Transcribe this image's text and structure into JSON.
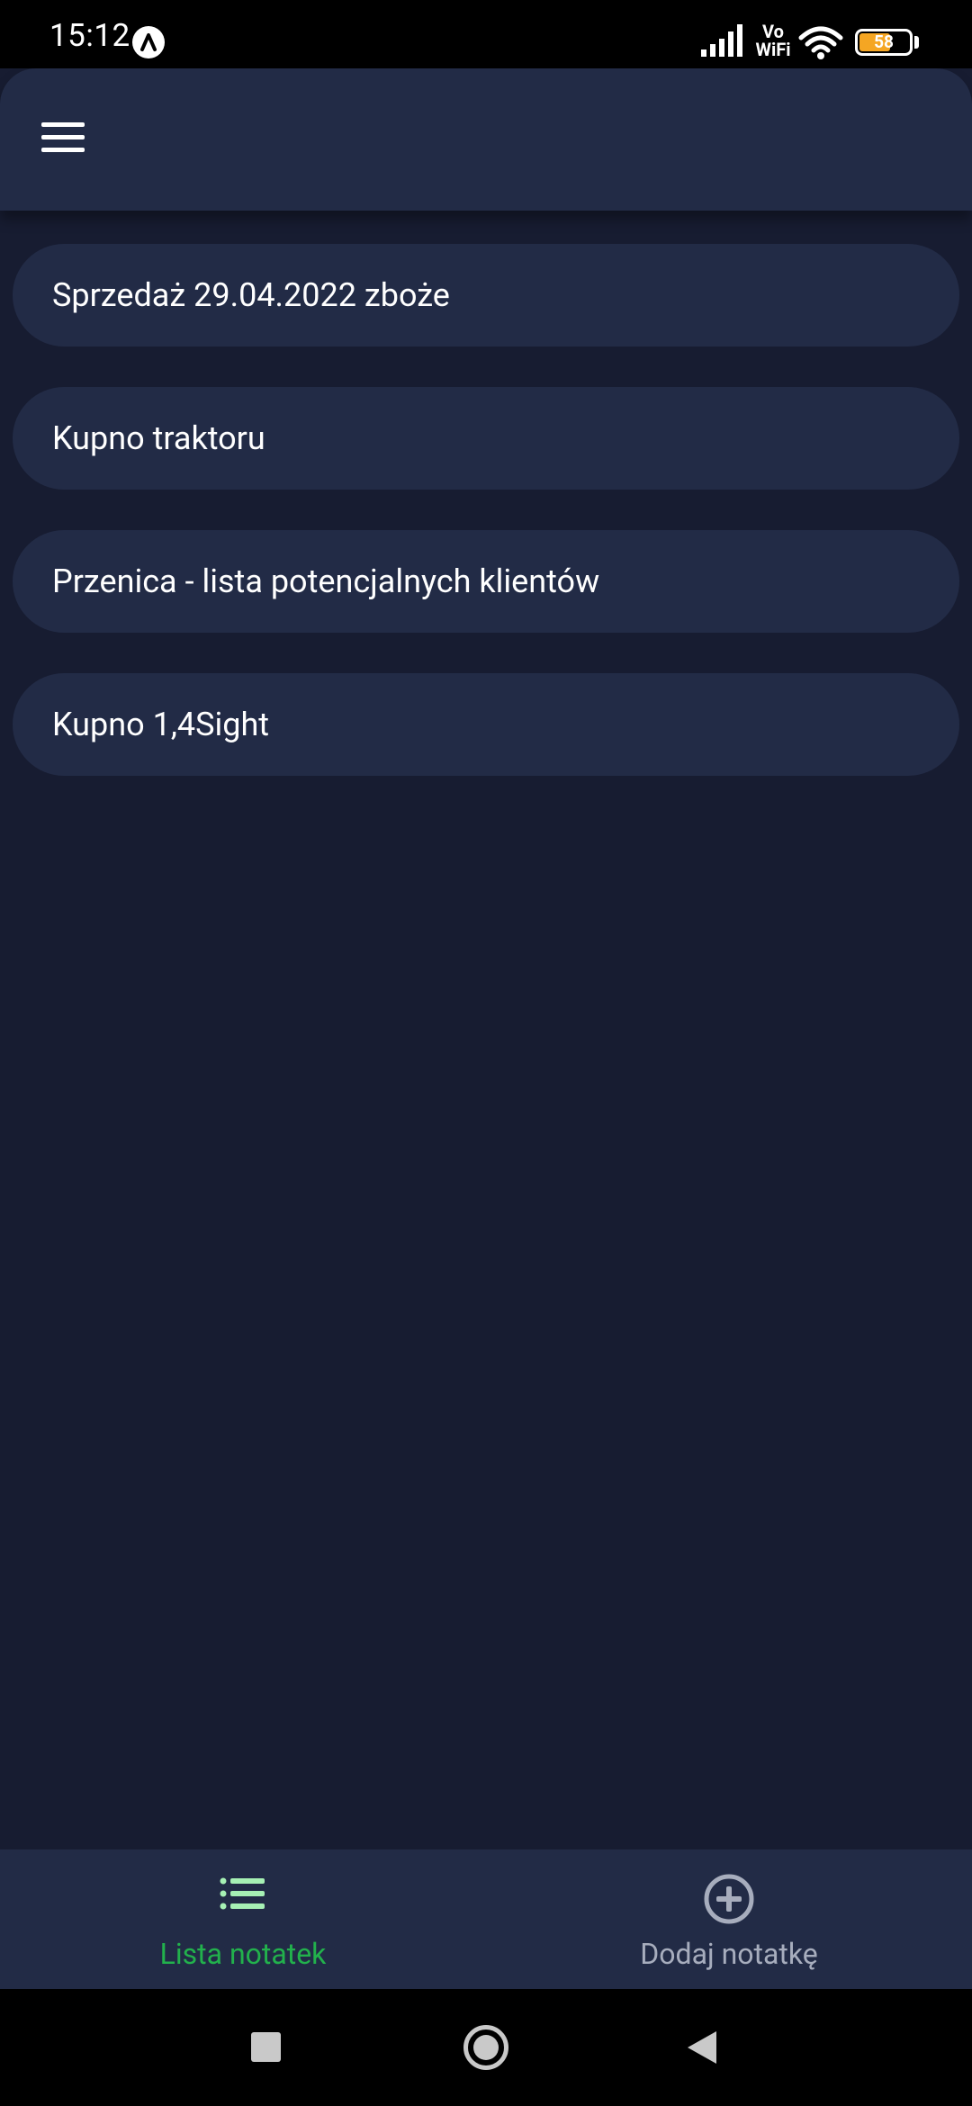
{
  "status_bar": {
    "time": "15:12",
    "network_label": "Vo\nWiFi",
    "battery_level": "58"
  },
  "header": {
    "menu_icon": "hamburger-menu-icon"
  },
  "notes": [
    {
      "title": "Sprzedaż 29.04.2022 zboże"
    },
    {
      "title": "Kupno traktoru"
    },
    {
      "title": "Przenica - lista potencjalnych klientów"
    },
    {
      "title": "Kupno 1,4Sight"
    }
  ],
  "bottom_nav": {
    "items": [
      {
        "label": "Lista notatek",
        "icon": "list-icon",
        "active": true,
        "color": "#22b14c"
      },
      {
        "label": "Dodaj notatkę",
        "icon": "add-circle-icon",
        "active": false,
        "color": "#a7adbd"
      }
    ]
  },
  "system_nav": {
    "recent_icon": "square-icon",
    "home_icon": "circle-icon",
    "back_icon": "triangle-back-icon"
  },
  "colors": {
    "background": "#171c31",
    "surface": "#222b46",
    "accent": "#22b14c",
    "battery": "#f5a623"
  }
}
